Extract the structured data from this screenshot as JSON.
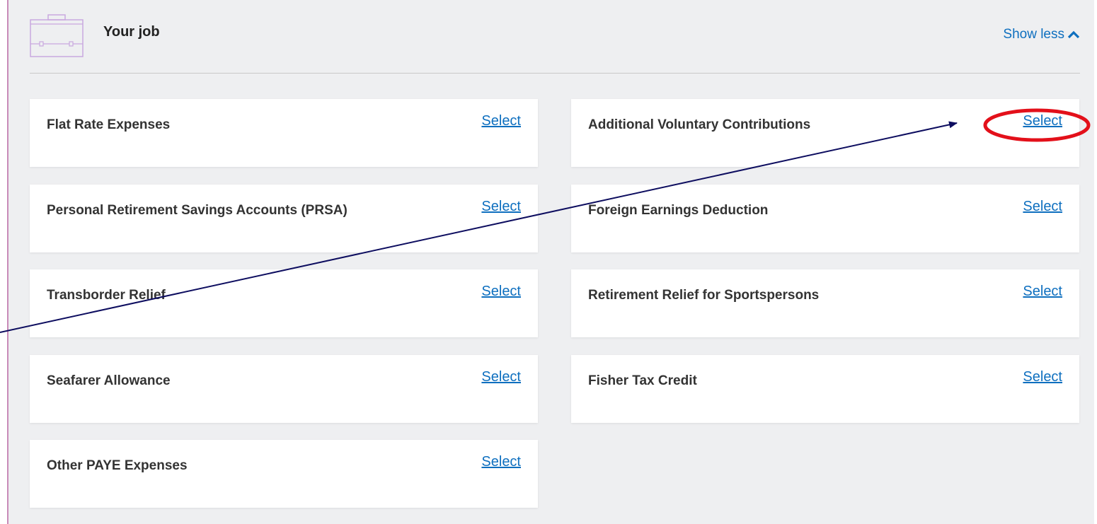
{
  "section": {
    "title": "Your job",
    "toggle_label": "Show less",
    "icon": "briefcase-icon",
    "toggle_icon": "chevron-up-icon"
  },
  "items": [
    {
      "title": "Flat Rate Expenses",
      "link": "Select"
    },
    {
      "title": "Additional Voluntary Contributions",
      "link": "Select"
    },
    {
      "title": "Personal Retirement Savings Accounts (PRSA)",
      "link": "Select"
    },
    {
      "title": "Foreign Earnings Deduction",
      "link": "Select"
    },
    {
      "title": "Transborder Relief",
      "link": "Select"
    },
    {
      "title": "Retirement Relief for Sportspersons",
      "link": "Select"
    },
    {
      "title": "Seafarer Allowance",
      "link": "Select"
    },
    {
      "title": "Fisher Tax Credit",
      "link": "Select"
    },
    {
      "title": "Other PAYE Expenses",
      "link": "Select"
    }
  ],
  "colors": {
    "panel_background": "#eeeff1",
    "panel_accent": "#c88bb8",
    "link": "#0e6fbf",
    "annotation_circle": "#e3101a",
    "annotation_arrow": "#0d0d5f"
  }
}
